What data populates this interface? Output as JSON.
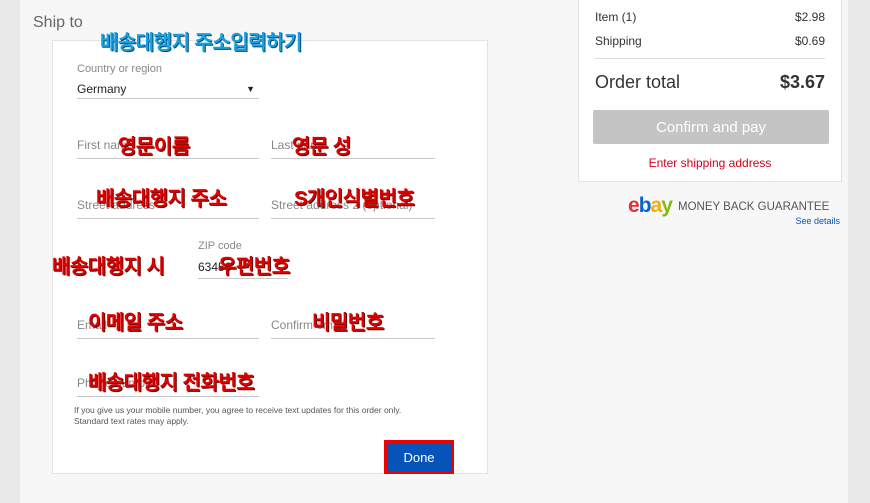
{
  "ship_to": {
    "title": "Ship to"
  },
  "form": {
    "country_label": "Country or region",
    "country_value": "Germany",
    "first_name_label": "First name",
    "last_name_label": "Last name",
    "street1_label": "Street address",
    "street2_label": "Street address 2 (optional)",
    "zip_label": "ZIP code",
    "zip_value": "63456",
    "email_label": "Email",
    "confirm_email_label": "Confirm email",
    "phone_label": "Phone number",
    "disclaimer": "If you give us your mobile number, you agree to receive text updates for this order only. Standard text rates may apply.",
    "done_label": "Done"
  },
  "annotations": {
    "address_input": "배송대행지 주소입력하기",
    "first_name": "영문이름",
    "last_name": "영문 성",
    "street": "배송대행지 주소",
    "street2": "S개인식별번호",
    "city": "배송대행지 시",
    "zip": "우편번호",
    "email": "이메일 주소",
    "password": "비밀번호",
    "phone": "배송대행지 전화번호"
  },
  "summary": {
    "item_label": "Item (1)",
    "item_price": "$2.98",
    "shipping_label": "Shipping",
    "shipping_price": "$0.69",
    "total_label": "Order total",
    "total_value": "$3.67",
    "confirm_label": "Confirm and pay",
    "warning": "Enter shipping address"
  },
  "guarantee": {
    "logo": {
      "e": "e",
      "b": "b",
      "a": "a",
      "y": "y"
    },
    "text": "MONEY BACK GUARANTEE",
    "link": "See details"
  },
  "colors": {
    "accent": "#0654ba",
    "warning": "#d0021b",
    "annotation_red": "#e00000",
    "annotation_blue": "#1aa0e0"
  }
}
